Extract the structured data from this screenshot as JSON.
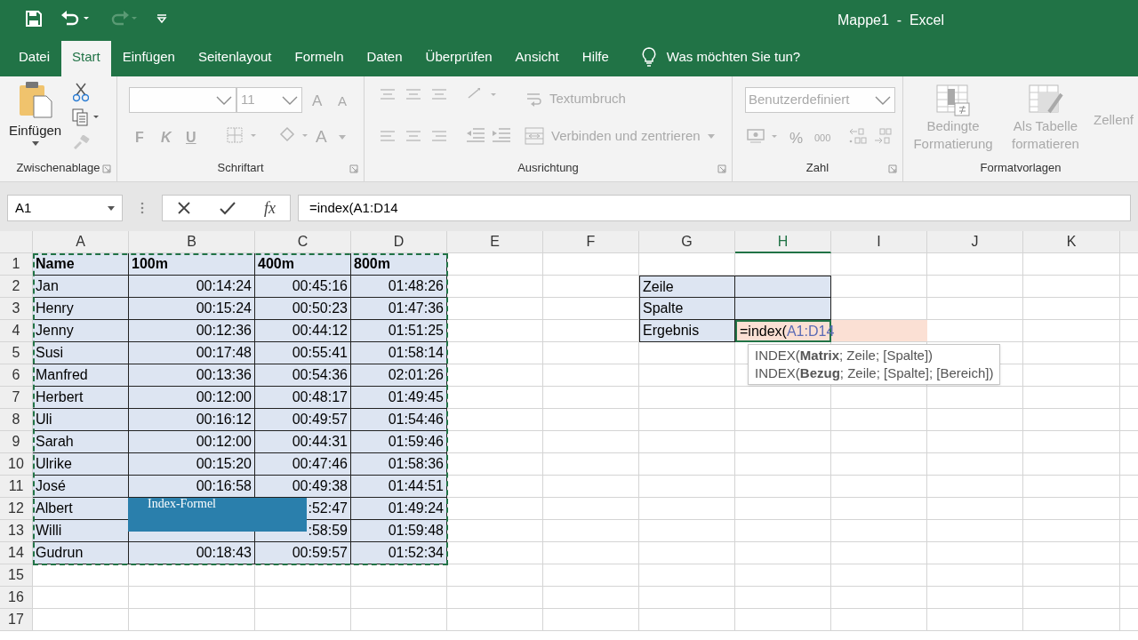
{
  "title_bar": {
    "title": "Mappe1  -  Excel"
  },
  "tabs": [
    {
      "label": "Datei",
      "selected": false
    },
    {
      "label": "Start",
      "selected": true
    },
    {
      "label": "Einfügen",
      "selected": false
    },
    {
      "label": "Seitenlayout",
      "selected": false
    },
    {
      "label": "Formeln",
      "selected": false
    },
    {
      "label": "Daten",
      "selected": false
    },
    {
      "label": "Überprüfen",
      "selected": false
    },
    {
      "label": "Ansicht",
      "selected": false
    },
    {
      "label": "Hilfe",
      "selected": false
    }
  ],
  "tell_me": {
    "placeholder": "Was möchten Sie tun?"
  },
  "ribbon": {
    "groups": [
      {
        "kind": "clipboard",
        "label": "Zwischenablage",
        "paste": "Einfügen",
        "disabled": false
      },
      {
        "kind": "font",
        "label": "Schriftart",
        "font_size": "11",
        "bold": "F",
        "italic": "K",
        "underline": "U",
        "grow": "A",
        "shrink": "A",
        "font_color": "A",
        "disabled": true
      },
      {
        "kind": "alignment",
        "label": "Ausrichtung",
        "wrap": "Textumbruch",
        "merge": "Verbinden und zentrieren",
        "disabled": true
      },
      {
        "kind": "number",
        "label": "Zahl",
        "format": "Benutzerdefiniert",
        "percent": "%",
        "thousands": "000",
        "disabled": true
      },
      {
        "kind": "styles",
        "label": "Formatvorlagen",
        "items": [
          "Bedingte Formatierung",
          "Als Tabelle formatieren",
          "Zellenf"
        ],
        "disabled": true
      }
    ]
  },
  "formula_bar": {
    "name_box": "A1",
    "function_label": "fx",
    "formula": "=index(A1:D14"
  },
  "sheet": {
    "columns": [
      {
        "label": "A",
        "selected": false
      },
      {
        "label": "B",
        "selected": false
      },
      {
        "label": "C",
        "selected": false
      },
      {
        "label": "D",
        "selected": false
      },
      {
        "label": "E",
        "selected": false
      },
      {
        "label": "F",
        "selected": false
      },
      {
        "label": "G",
        "selected": false
      },
      {
        "label": "H",
        "selected": true
      },
      {
        "label": "I",
        "selected": false
      },
      {
        "label": "J",
        "selected": false
      },
      {
        "label": "K",
        "selected": false
      }
    ],
    "rows": [
      {
        "header": "1",
        "cells": {
          "A": "Name",
          "B": "100m",
          "C": "400m",
          "D": "800m"
        }
      },
      {
        "header": "2",
        "cells": {
          "A": "Jan",
          "B": "00:14:24",
          "C": "00:45:16",
          "D": "01:48:26",
          "G": "Zeile"
        }
      },
      {
        "header": "3",
        "cells": {
          "A": "Henry",
          "B": "00:15:24",
          "C": "00:50:23",
          "D": "01:47:36",
          "G": "Spalte"
        }
      },
      {
        "header": "4",
        "cells": {
          "A": "Jenny",
          "B": "00:12:36",
          "C": "00:44:12",
          "D": "01:51:25",
          "G": "Ergebnis"
        }
      },
      {
        "header": "5",
        "cells": {
          "A": "Susi",
          "B": "00:17:48",
          "C": "00:55:41",
          "D": "01:58:14"
        }
      },
      {
        "header": "6",
        "cells": {
          "A": "Manfred",
          "B": "00:13:36",
          "C": "00:54:36",
          "D": "02:01:26"
        }
      },
      {
        "header": "7",
        "cells": {
          "A": "Herbert",
          "B": "00:12:00",
          "C": "00:48:17",
          "D": "01:49:45"
        }
      },
      {
        "header": "8",
        "cells": {
          "A": "Uli",
          "B": "00:16:12",
          "C": "00:49:57",
          "D": "01:54:46"
        }
      },
      {
        "header": "9",
        "cells": {
          "A": "Sarah",
          "B": "00:12:00",
          "C": "00:44:31",
          "D": "01:59:46"
        }
      },
      {
        "header": "10",
        "cells": {
          "A": "Ulrike",
          "B": "00:15:20",
          "C": "00:47:46",
          "D": "01:58:36"
        }
      },
      {
        "header": "11",
        "cells": {
          "A": "José",
          "B": "00:16:58",
          "C": "00:49:38",
          "D": "01:44:51"
        }
      },
      {
        "header": "12",
        "cells": {
          "A": "Albert",
          "C": ":52:47",
          "D": "01:49:24"
        }
      },
      {
        "header": "13",
        "cells": {
          "A": "Willi",
          "C": ":58:59",
          "D": "01:59:48"
        }
      },
      {
        "header": "14",
        "cells": {
          "A": "Gudrun",
          "B": "00:18:43",
          "C": "00:59:57",
          "D": "01:52:34"
        }
      },
      {
        "header": "15",
        "cells": {}
      },
      {
        "header": "16",
        "cells": {}
      },
      {
        "header": "17",
        "cells": {}
      }
    ],
    "editing_cell": {
      "prefix": "=index(",
      "reference": "A1:D14"
    },
    "tooltip": [
      "INDEX(**Matrix**; Zeile; [Spalte])",
      "INDEX(**Bezug**; Zeile; [Spalte]; [Bereich])"
    ]
  },
  "annotation": {
    "text": "Index-Formel"
  }
}
